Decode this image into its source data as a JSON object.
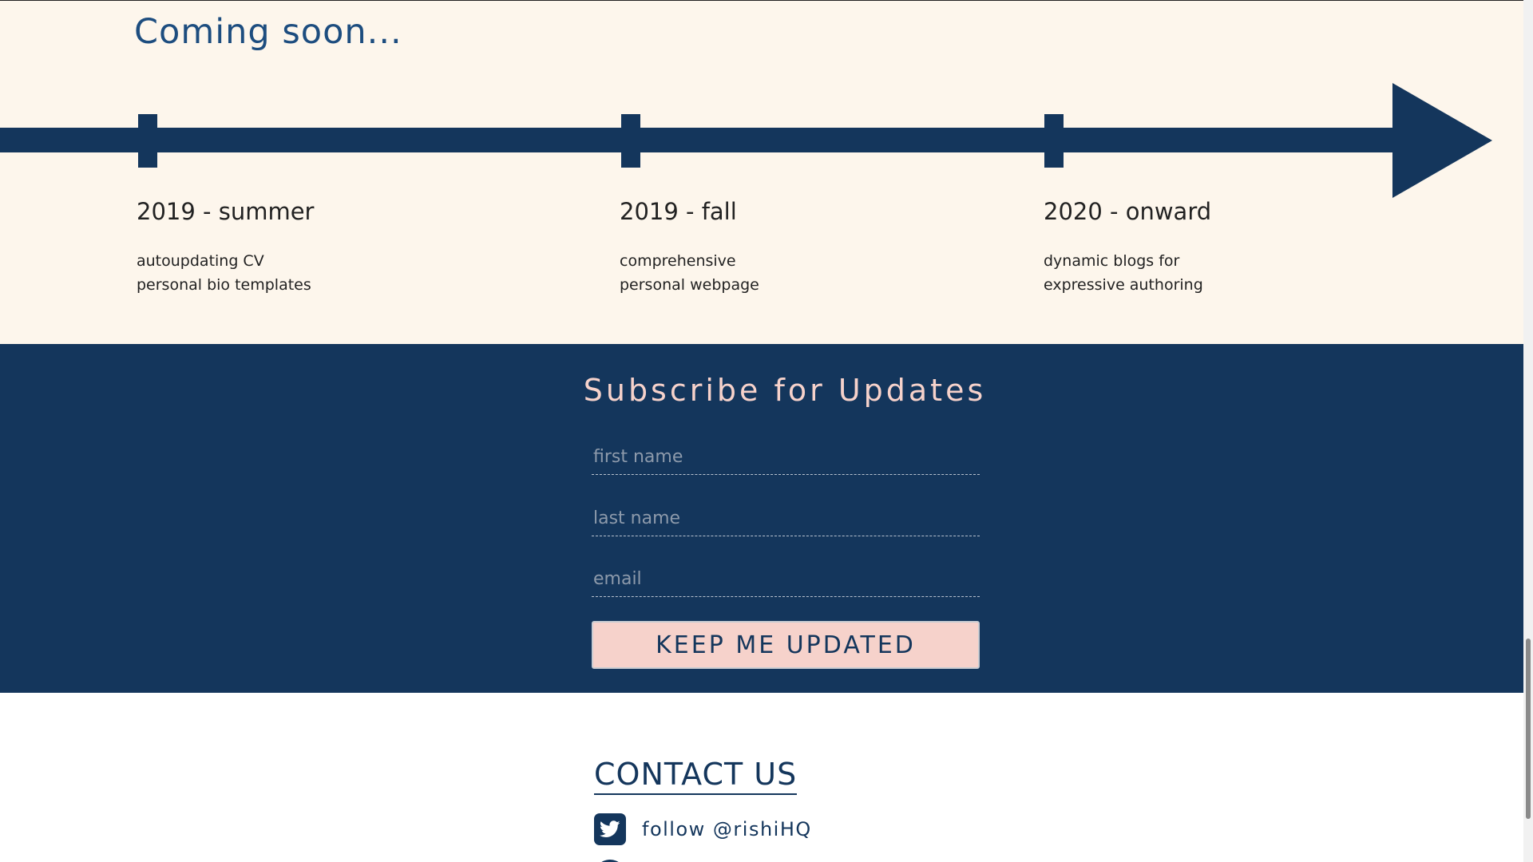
{
  "timeline": {
    "title": "Coming soon...",
    "milestones": [
      {
        "date": "2019 - summer",
        "lines": [
          "autoupdating CV",
          "personal bio templates"
        ]
      },
      {
        "date": "2019 - fall",
        "lines": [
          "comprehensive",
          "personal webpage"
        ]
      },
      {
        "date": "2020 - onward",
        "lines": [
          "dynamic blogs for",
          "expressive authoring"
        ]
      }
    ]
  },
  "subscribe": {
    "title": "Subscribe for Updates",
    "first_name_placeholder": "first name",
    "last_name_placeholder": "last name",
    "email_placeholder": "email",
    "button_label": "KEEP ME UPDATED"
  },
  "contact": {
    "title": "CONTACT US",
    "twitter_label": "follow @rishiHQ",
    "twitter_icon": "twitter-icon"
  },
  "colors": {
    "navy": "#14365c",
    "cream": "#fdf6ec",
    "pink": "#f6d2cb",
    "title_blue": "#1d4d7f"
  }
}
